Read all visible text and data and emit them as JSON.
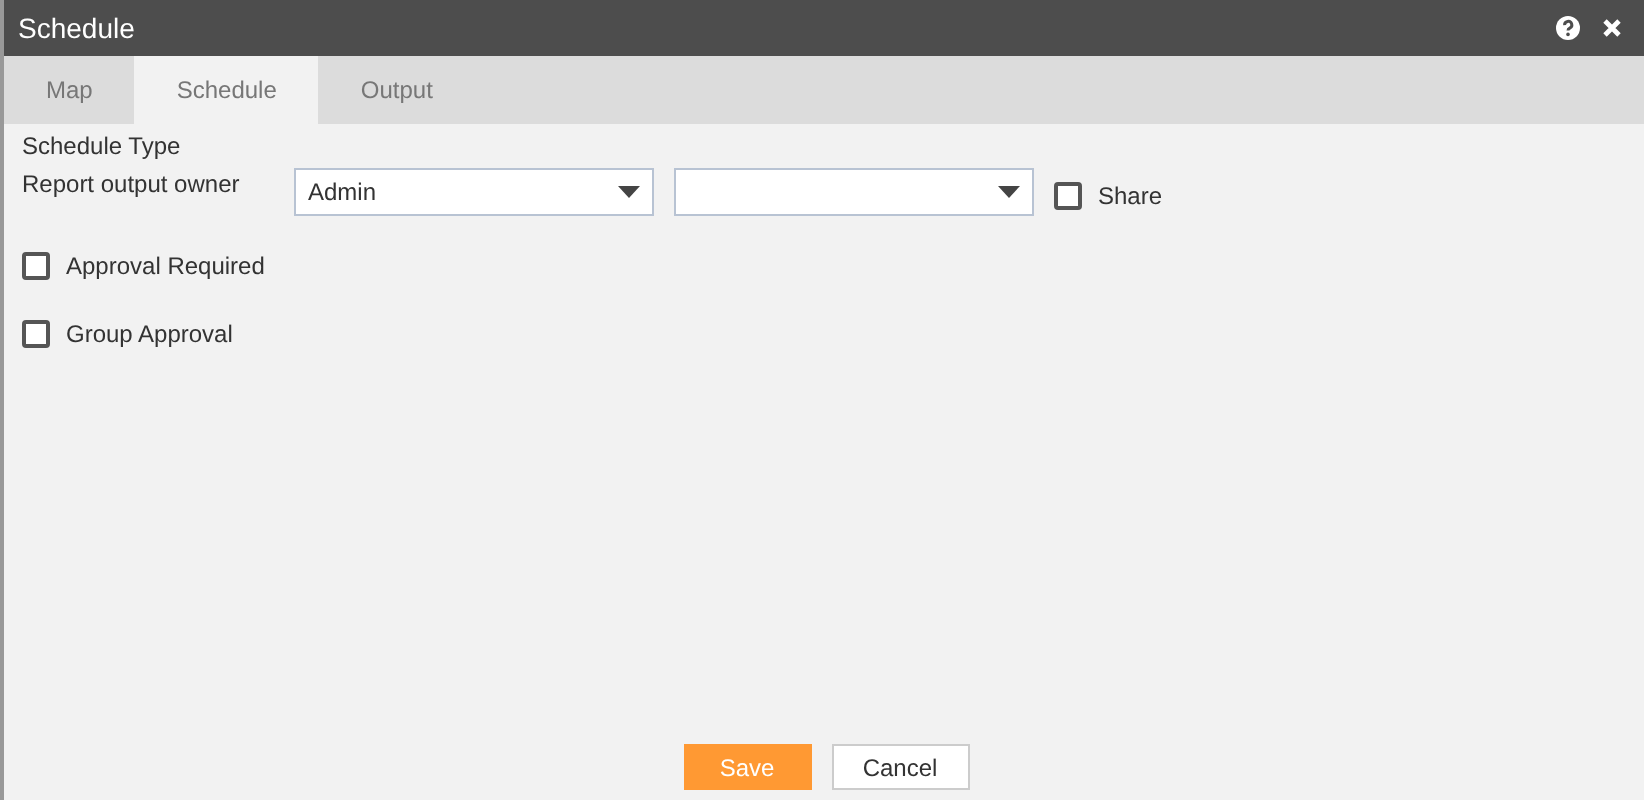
{
  "window": {
    "title": "Schedule"
  },
  "tabs": [
    {
      "label": "Map",
      "selected": false
    },
    {
      "label": "Schedule",
      "selected": true
    },
    {
      "label": "Output",
      "selected": false
    }
  ],
  "section_title": "Schedule Type",
  "owner": {
    "label": "Report output owner",
    "dropdowns": [
      {
        "kind": "dropdown",
        "value": "Admin"
      },
      {
        "kind": "dropdown"
      }
    ],
    "share": {
      "label": "Share",
      "checked": false
    }
  },
  "options": [
    {
      "label": "Approval Required",
      "checked": false
    },
    {
      "label": "Group Approval",
      "checked": false
    }
  ],
  "buttons": [
    {
      "label": "Save",
      "kind": "primary"
    },
    {
      "label": "Cancel",
      "kind": "secondary"
    }
  ]
}
